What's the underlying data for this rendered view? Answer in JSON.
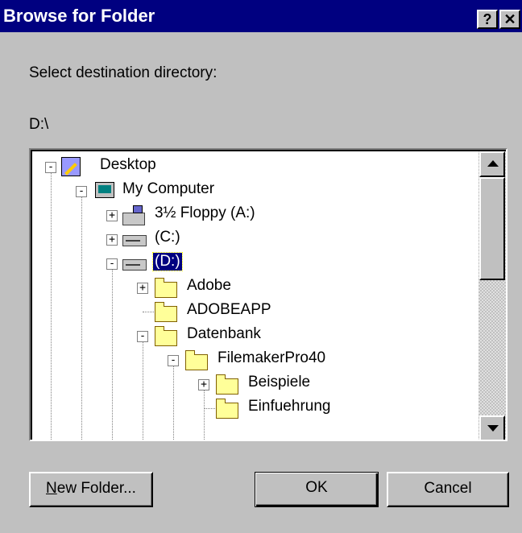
{
  "window": {
    "title": "Browse for Folder",
    "help_label": "?",
    "close_label": "✕"
  },
  "prompt": "Select destination directory:",
  "current_path": "D:\\",
  "tree": {
    "selected": "(D:)",
    "items": [
      {
        "label": "Desktop",
        "icon": "desktop-icon",
        "expander": "-"
      },
      {
        "label": "My Computer",
        "icon": "computer-icon",
        "expander": "-"
      },
      {
        "label": "3½ Floppy (A:)",
        "icon": "floppy-drive-icon",
        "expander": "+"
      },
      {
        "label": "(C:)",
        "icon": "hard-drive-icon",
        "expander": "+"
      },
      {
        "label": "(D:)",
        "icon": "hard-drive-icon",
        "expander": "-"
      },
      {
        "label": "Adobe",
        "icon": "folder-icon",
        "expander": "+"
      },
      {
        "label": "ADOBEAPP",
        "icon": "folder-icon",
        "expander": ""
      },
      {
        "label": "Datenbank",
        "icon": "folder-icon",
        "expander": "-"
      },
      {
        "label": "FilemakerPro40",
        "icon": "folder-icon",
        "expander": "-"
      },
      {
        "label": "Beispiele",
        "icon": "folder-icon",
        "expander": "+"
      },
      {
        "label": "Einfuehrung",
        "icon": "folder-icon",
        "expander": ""
      }
    ]
  },
  "buttons": {
    "new_folder_accel": "N",
    "new_folder_rest": "ew Folder...",
    "ok": "OK",
    "cancel": "Cancel"
  },
  "colors": {
    "titlebar": "#000080",
    "face": "#c0c0c0",
    "selection": "#000080"
  }
}
